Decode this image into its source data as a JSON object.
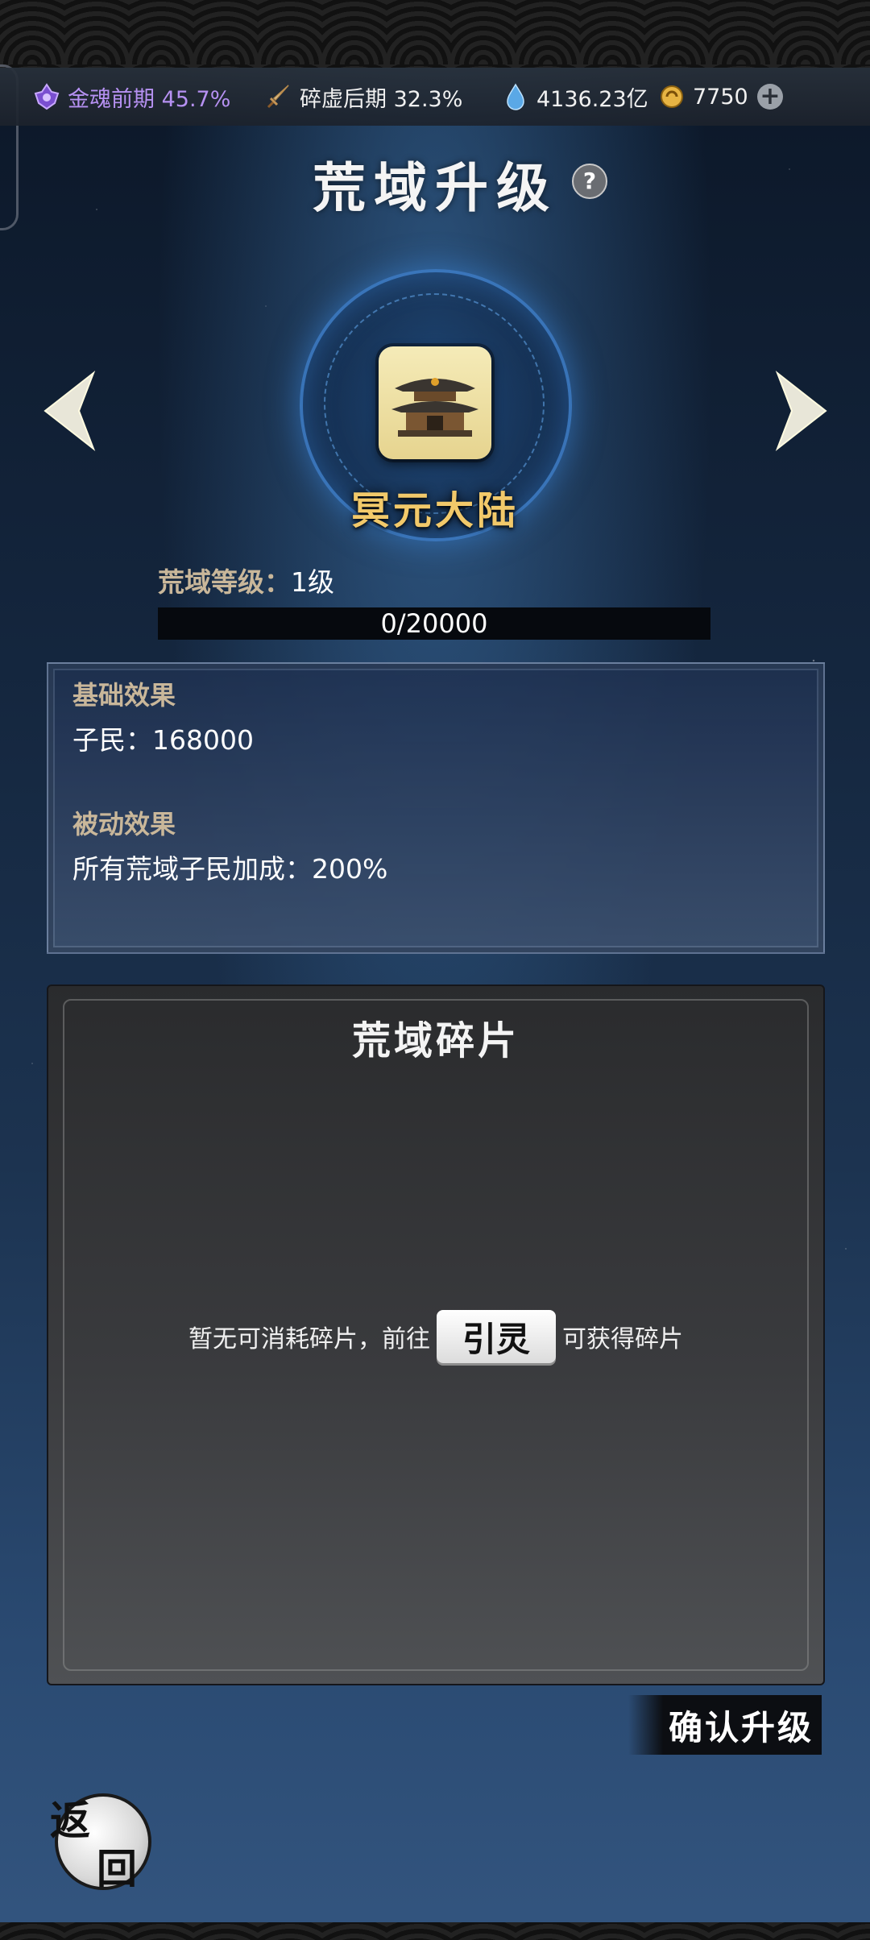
{
  "resources": {
    "realm": {
      "icon": "amethyst-realm-icon",
      "text": "金魂前期 45.7%"
    },
    "sword": {
      "icon": "sword-icon",
      "text": "碎虚后期 32.3%"
    },
    "spirit": {
      "icon": "spirit-drop-icon",
      "text": "4136.23亿"
    },
    "coin": {
      "icon": "gold-coin-icon",
      "text": "7750"
    },
    "add": "+"
  },
  "page": {
    "title": "荒域升级",
    "help": "?"
  },
  "region": {
    "name": "冥元大陆",
    "icon": "palace-icon"
  },
  "level": {
    "label": "荒域等级：",
    "value": "1级",
    "progress_text": "0/20000",
    "progress_current": 0,
    "progress_max": 20000
  },
  "effects": {
    "basic_title": "基础效果",
    "basic_text": "子民：168000",
    "passive_title": "被动效果",
    "passive_text": "所有荒域子民加成：200%"
  },
  "fragments": {
    "title": "荒域碎片",
    "empty_prefix": "暂无可消耗碎片，前往",
    "guide_button": "引灵",
    "empty_suffix": "可获得碎片"
  },
  "actions": {
    "confirm": "确认升级",
    "back_1": "返",
    "back_2": "回"
  },
  "colors": {
    "realm_text": "#b691f2",
    "region_name": "#f2c96a",
    "section_heading": "#c9b79a"
  }
}
